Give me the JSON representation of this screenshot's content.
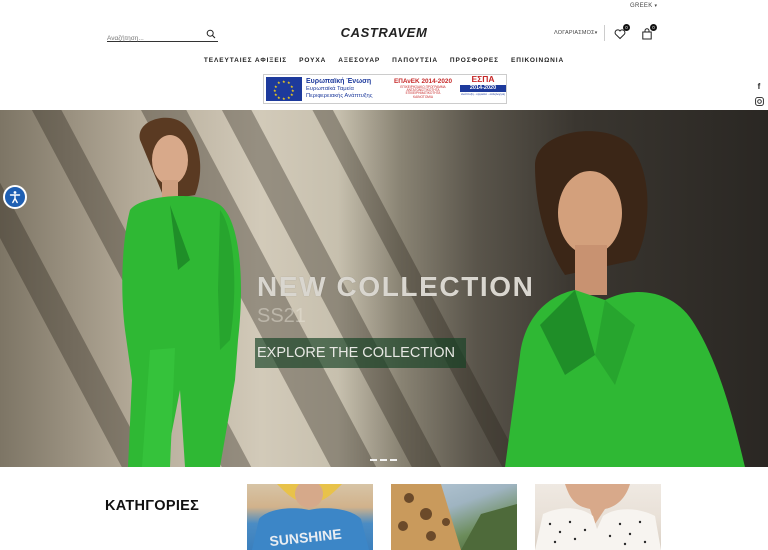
{
  "language": {
    "label": "GREEK"
  },
  "header": {
    "search_placeholder": "Αναζήτηση...",
    "logo": "CASTRAVEM",
    "account_label": "ΛΟΓΑΡΙΑΣΜΟΣ",
    "wishlist_count": "0",
    "cart_count": "0"
  },
  "nav": {
    "items": [
      "ΤΕΛΕΥΤΑΙΕΣ ΑΦΙΞΕΙΣ",
      "ΡΟΥΧΑ",
      "ΑΞΕΣΟΥΑΡ",
      "ΠΑΠΟΥΤΣΙΑ",
      "ΠΡΟΣΦΟΡΕΣ",
      "ΕΠΙΚΟΙΝΩΝΙΑ"
    ]
  },
  "eu_banner": {
    "eu_title": "Ευρωπαϊκή Ένωση",
    "eu_line1": "Ευρωπαϊκά Ταμεία",
    "eu_line2": "Περιφερειακής Ανάπτυξης",
    "epanek_title": "ΕΠΑνΕΚ 2014-2020",
    "epanek_line1": "ΕΠΙΧΕΙΡΗΣΙΑΚΟ ΠΡΟΓΡΑΜΜΑ",
    "epanek_line2": "ΑΝΤΑΓΩΝΙΣΤΙΚΟΤΗΤΑ",
    "epanek_line3": "ΕΠΙΧΕΙΡΗΜΑΤΙΚΟΤΗΤΑ",
    "epanek_line4": "ΚΑΙΝΟΤΟΜΙΑ",
    "espa_title": "ΕΣΠΑ",
    "espa_years": "2014-2020",
    "espa_line": "ανάπτυξη - εργασία - αλληλεγγύη"
  },
  "social": {
    "facebook": "f",
    "instagram": "instagram-icon",
    "email": "email-icon"
  },
  "hero": {
    "headline": "NEW COLLECTION",
    "subline": "SS21",
    "cta_label": "EXPLORE THE COLLECTION",
    "slides_total": 3,
    "active_slide": 1
  },
  "categories": {
    "title": "ΚΑΤΗΓΟΡΙΕΣ",
    "card1_text": "SUNSHINE"
  },
  "colors": {
    "accent_green": "#2fb834",
    "eu_blue": "#1d3a9c",
    "eu_red": "#c62828",
    "access_blue": "#1e5fb3"
  }
}
